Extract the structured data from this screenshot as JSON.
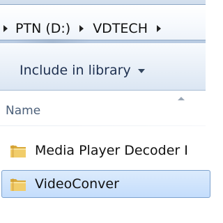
{
  "address_bar": {
    "breadcrumbs": [
      "PTN (D:)",
      "VDTECH"
    ]
  },
  "toolbar": {
    "include_in_library_label": "Include in library"
  },
  "columns": {
    "name_header": "Name"
  },
  "files": [
    {
      "name": "Media Player Decoder I",
      "type": "folder",
      "selected": false
    },
    {
      "name": "VideoConver",
      "type": "folder",
      "selected": true
    }
  ],
  "colors": {
    "selection_fill": "#cfe3fc",
    "selection_border": "#7da2ce",
    "folder": "#e9c35a"
  }
}
